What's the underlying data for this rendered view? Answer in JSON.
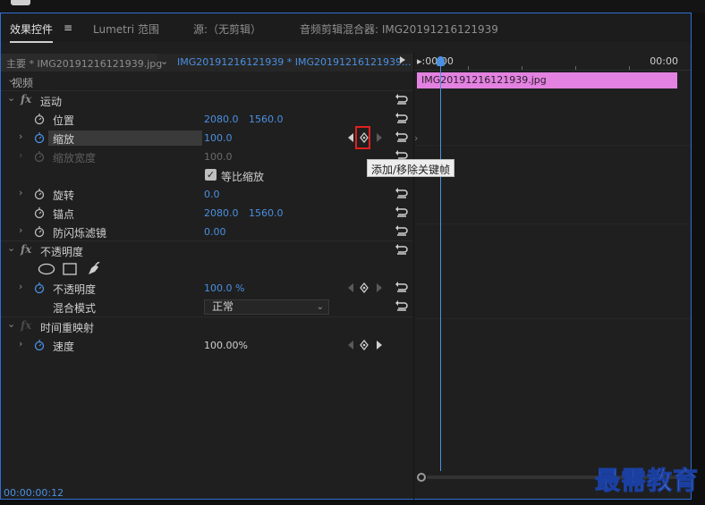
{
  "tabs": [
    {
      "label": "效果控件",
      "active": true
    },
    {
      "label": "Lumetri 范围",
      "active": false
    },
    {
      "label": "源:（无剪辑）",
      "active": false
    },
    {
      "label": "音频剪辑混合器: IMG20191216121939",
      "active": false
    }
  ],
  "menu_icon": "≡",
  "clip": {
    "master": "主要 * IMG20191216121939.jpg",
    "sequence": "IMG20191216121939 * IMG20191216121939...",
    "chevron": "⌄"
  },
  "sections": {
    "video": "视频",
    "motion": "运动",
    "opacity": "不透明度",
    "time_remap": "时间重映射"
  },
  "properties": {
    "position": {
      "label": "位置",
      "x": "2080.0",
      "y": "1560.0"
    },
    "scale": {
      "label": "缩放",
      "value": "100.0"
    },
    "scale_width": {
      "label": "缩放宽度",
      "value": "100.0"
    },
    "uniform_scale": {
      "label": "等比缩放",
      "checked": true,
      "check": "✓"
    },
    "rotation": {
      "label": "旋转",
      "value": "0.0"
    },
    "anchor": {
      "label": "锚点",
      "x": "2080.0",
      "y": "1560.0"
    },
    "antiflicker": {
      "label": "防闪烁滤镜",
      "value": "0.00"
    },
    "opacity": {
      "label": "不透明度",
      "value": "100.0 %"
    },
    "blend_mode": {
      "label": "混合模式",
      "value": "正常",
      "caret": "⌄"
    },
    "speed": {
      "label": "速度",
      "value": "100.00%"
    }
  },
  "fx_glyph": "fx",
  "twist_glyph": "›",
  "open_glyph": "⌄",
  "timeline": {
    "start": "▸:00:00",
    "end": "00:00",
    "clip_name": "IMG20191216121939.jpg",
    "clip_color": "#e382e0",
    "arrow": "›"
  },
  "timecode": "00:00:00:12",
  "tooltip": "添加/移除关键帧",
  "watermark": "最需教育",
  "colors": {
    "accent": "#4a90e2",
    "highlight": "#e0201d"
  }
}
